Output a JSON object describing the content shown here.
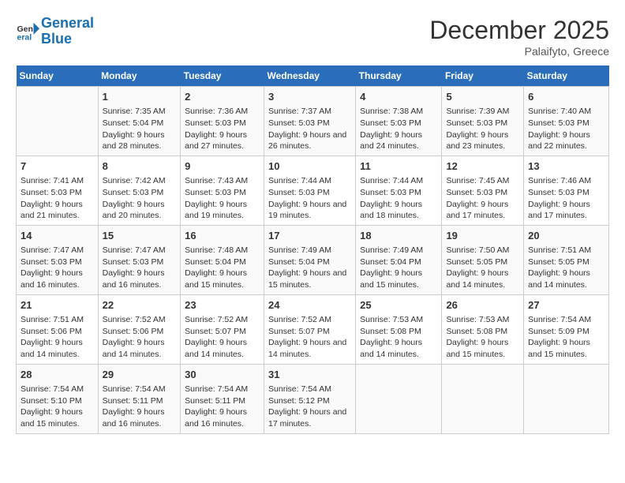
{
  "header": {
    "logo_line1": "General",
    "logo_line2": "Blue",
    "month": "December 2025",
    "location": "Palaifyto, Greece"
  },
  "weekdays": [
    "Sunday",
    "Monday",
    "Tuesday",
    "Wednesday",
    "Thursday",
    "Friday",
    "Saturday"
  ],
  "weeks": [
    [
      {
        "day": "",
        "sunrise": "",
        "sunset": "",
        "daylight": ""
      },
      {
        "day": "1",
        "sunrise": "Sunrise: 7:35 AM",
        "sunset": "Sunset: 5:04 PM",
        "daylight": "Daylight: 9 hours and 28 minutes."
      },
      {
        "day": "2",
        "sunrise": "Sunrise: 7:36 AM",
        "sunset": "Sunset: 5:03 PM",
        "daylight": "Daylight: 9 hours and 27 minutes."
      },
      {
        "day": "3",
        "sunrise": "Sunrise: 7:37 AM",
        "sunset": "Sunset: 5:03 PM",
        "daylight": "Daylight: 9 hours and 26 minutes."
      },
      {
        "day": "4",
        "sunrise": "Sunrise: 7:38 AM",
        "sunset": "Sunset: 5:03 PM",
        "daylight": "Daylight: 9 hours and 24 minutes."
      },
      {
        "day": "5",
        "sunrise": "Sunrise: 7:39 AM",
        "sunset": "Sunset: 5:03 PM",
        "daylight": "Daylight: 9 hours and 23 minutes."
      },
      {
        "day": "6",
        "sunrise": "Sunrise: 7:40 AM",
        "sunset": "Sunset: 5:03 PM",
        "daylight": "Daylight: 9 hours and 22 minutes."
      }
    ],
    [
      {
        "day": "7",
        "sunrise": "Sunrise: 7:41 AM",
        "sunset": "Sunset: 5:03 PM",
        "daylight": "Daylight: 9 hours and 21 minutes."
      },
      {
        "day": "8",
        "sunrise": "Sunrise: 7:42 AM",
        "sunset": "Sunset: 5:03 PM",
        "daylight": "Daylight: 9 hours and 20 minutes."
      },
      {
        "day": "9",
        "sunrise": "Sunrise: 7:43 AM",
        "sunset": "Sunset: 5:03 PM",
        "daylight": "Daylight: 9 hours and 19 minutes."
      },
      {
        "day": "10",
        "sunrise": "Sunrise: 7:44 AM",
        "sunset": "Sunset: 5:03 PM",
        "daylight": "Daylight: 9 hours and 19 minutes."
      },
      {
        "day": "11",
        "sunrise": "Sunrise: 7:44 AM",
        "sunset": "Sunset: 5:03 PM",
        "daylight": "Daylight: 9 hours and 18 minutes."
      },
      {
        "day": "12",
        "sunrise": "Sunrise: 7:45 AM",
        "sunset": "Sunset: 5:03 PM",
        "daylight": "Daylight: 9 hours and 17 minutes."
      },
      {
        "day": "13",
        "sunrise": "Sunrise: 7:46 AM",
        "sunset": "Sunset: 5:03 PM",
        "daylight": "Daylight: 9 hours and 17 minutes."
      }
    ],
    [
      {
        "day": "14",
        "sunrise": "Sunrise: 7:47 AM",
        "sunset": "Sunset: 5:03 PM",
        "daylight": "Daylight: 9 hours and 16 minutes."
      },
      {
        "day": "15",
        "sunrise": "Sunrise: 7:47 AM",
        "sunset": "Sunset: 5:03 PM",
        "daylight": "Daylight: 9 hours and 16 minutes."
      },
      {
        "day": "16",
        "sunrise": "Sunrise: 7:48 AM",
        "sunset": "Sunset: 5:04 PM",
        "daylight": "Daylight: 9 hours and 15 minutes."
      },
      {
        "day": "17",
        "sunrise": "Sunrise: 7:49 AM",
        "sunset": "Sunset: 5:04 PM",
        "daylight": "Daylight: 9 hours and 15 minutes."
      },
      {
        "day": "18",
        "sunrise": "Sunrise: 7:49 AM",
        "sunset": "Sunset: 5:04 PM",
        "daylight": "Daylight: 9 hours and 15 minutes."
      },
      {
        "day": "19",
        "sunrise": "Sunrise: 7:50 AM",
        "sunset": "Sunset: 5:05 PM",
        "daylight": "Daylight: 9 hours and 14 minutes."
      },
      {
        "day": "20",
        "sunrise": "Sunrise: 7:51 AM",
        "sunset": "Sunset: 5:05 PM",
        "daylight": "Daylight: 9 hours and 14 minutes."
      }
    ],
    [
      {
        "day": "21",
        "sunrise": "Sunrise: 7:51 AM",
        "sunset": "Sunset: 5:06 PM",
        "daylight": "Daylight: 9 hours and 14 minutes."
      },
      {
        "day": "22",
        "sunrise": "Sunrise: 7:52 AM",
        "sunset": "Sunset: 5:06 PM",
        "daylight": "Daylight: 9 hours and 14 minutes."
      },
      {
        "day": "23",
        "sunrise": "Sunrise: 7:52 AM",
        "sunset": "Sunset: 5:07 PM",
        "daylight": "Daylight: 9 hours and 14 minutes."
      },
      {
        "day": "24",
        "sunrise": "Sunrise: 7:52 AM",
        "sunset": "Sunset: 5:07 PM",
        "daylight": "Daylight: 9 hours and 14 minutes."
      },
      {
        "day": "25",
        "sunrise": "Sunrise: 7:53 AM",
        "sunset": "Sunset: 5:08 PM",
        "daylight": "Daylight: 9 hours and 14 minutes."
      },
      {
        "day": "26",
        "sunrise": "Sunrise: 7:53 AM",
        "sunset": "Sunset: 5:08 PM",
        "daylight": "Daylight: 9 hours and 15 minutes."
      },
      {
        "day": "27",
        "sunrise": "Sunrise: 7:54 AM",
        "sunset": "Sunset: 5:09 PM",
        "daylight": "Daylight: 9 hours and 15 minutes."
      }
    ],
    [
      {
        "day": "28",
        "sunrise": "Sunrise: 7:54 AM",
        "sunset": "Sunset: 5:10 PM",
        "daylight": "Daylight: 9 hours and 15 minutes."
      },
      {
        "day": "29",
        "sunrise": "Sunrise: 7:54 AM",
        "sunset": "Sunset: 5:11 PM",
        "daylight": "Daylight: 9 hours and 16 minutes."
      },
      {
        "day": "30",
        "sunrise": "Sunrise: 7:54 AM",
        "sunset": "Sunset: 5:11 PM",
        "daylight": "Daylight: 9 hours and 16 minutes."
      },
      {
        "day": "31",
        "sunrise": "Sunrise: 7:54 AM",
        "sunset": "Sunset: 5:12 PM",
        "daylight": "Daylight: 9 hours and 17 minutes."
      },
      {
        "day": "",
        "sunrise": "",
        "sunset": "",
        "daylight": ""
      },
      {
        "day": "",
        "sunrise": "",
        "sunset": "",
        "daylight": ""
      },
      {
        "day": "",
        "sunrise": "",
        "sunset": "",
        "daylight": ""
      }
    ]
  ]
}
